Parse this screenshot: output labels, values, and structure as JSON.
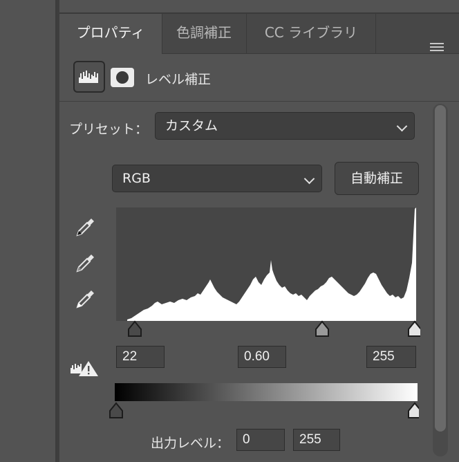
{
  "tabs": [
    {
      "label": "プロパティ",
      "active": true
    },
    {
      "label": "色調補正",
      "active": false
    },
    {
      "label": "CC ライブラリ",
      "active": false
    }
  ],
  "panel_menu_icon": "hamburger-menu-icon",
  "adjustment": {
    "title": "レベル補正",
    "icons": [
      "levels-adjustment-icon",
      "layer-mask-icon"
    ]
  },
  "preset": {
    "label": "プリセット：",
    "value": "カスタム"
  },
  "channel": {
    "value": "RGB"
  },
  "auto_button": "自動補正",
  "input_levels": {
    "black": "22",
    "gamma": "0.60",
    "white": "255"
  },
  "output": {
    "label": "出力レベル：",
    "black": "0",
    "white": "255"
  },
  "colors": {
    "panel_bg": "#535353",
    "histogram_bg": "#464646",
    "histogram_fill": "#ffffff"
  }
}
